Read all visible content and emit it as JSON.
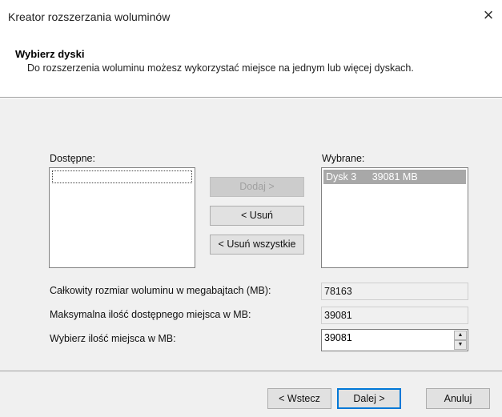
{
  "window": {
    "title": "Kreator rozszerzania woluminów",
    "close_icon": "×"
  },
  "header": {
    "title": "Wybierz dyski",
    "description": "Do rozszerzenia woluminu możesz wykorzystać miejsce na jednym lub więcej dyskach."
  },
  "available": {
    "label": "Dostępne:",
    "items": []
  },
  "selected": {
    "label": "Wybrane:",
    "items": [
      {
        "disk": "Dysk 3",
        "size": "39081 MB"
      }
    ]
  },
  "buttons": {
    "add": "Dodaj >",
    "remove": "< Usuń",
    "remove_all": "< Usuń wszystkie",
    "back": "< Wstecz",
    "next": "Dalej >",
    "cancel": "Anuluj"
  },
  "fields": {
    "total_label": "Całkowity rozmiar woluminu w megabajtach (MB):",
    "total_value": "78163",
    "max_label": "Maksymalna ilość dostępnego miejsca w MB:",
    "max_value": "39081",
    "choose_label": "Wybierz ilość miejsca w MB:",
    "choose_value": "39081",
    "up_arrow": "▲",
    "down_arrow": "▼"
  }
}
